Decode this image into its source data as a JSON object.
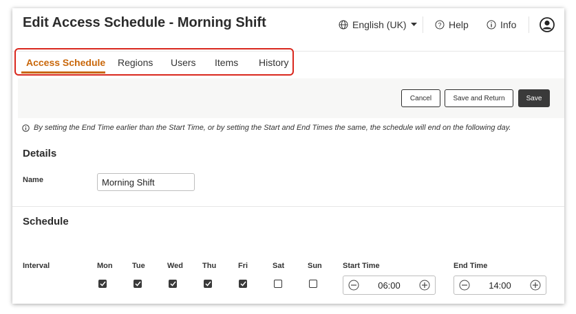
{
  "header": {
    "title": "Edit Access Schedule - Morning Shift",
    "language": "English (UK)",
    "help": "Help",
    "info": "Info"
  },
  "tabs": [
    {
      "label": "Access Schedule",
      "active": true
    },
    {
      "label": "Regions",
      "active": false
    },
    {
      "label": "Users",
      "active": false
    },
    {
      "label": "Items",
      "active": false
    },
    {
      "label": "History",
      "active": false
    }
  ],
  "toolbar": {
    "cancel": "Cancel",
    "save_and_return": "Save and Return",
    "save": "Save"
  },
  "info_text": "By setting the End Time earlier than the Start Time, or by setting the Start and End Times the same, the schedule will end on the following day.",
  "details": {
    "title": "Details",
    "name_label": "Name",
    "name_value": "Morning Shift"
  },
  "schedule": {
    "title": "Schedule",
    "interval_label": "Interval",
    "days": [
      {
        "label": "Mon",
        "checked": true
      },
      {
        "label": "Tue",
        "checked": true
      },
      {
        "label": "Wed",
        "checked": true
      },
      {
        "label": "Thu",
        "checked": true
      },
      {
        "label": "Fri",
        "checked": true
      },
      {
        "label": "Sat",
        "checked": false
      },
      {
        "label": "Sun",
        "checked": false
      }
    ],
    "start_time_label": "Start Time",
    "start_time": "06:00",
    "end_time_label": "End Time",
    "end_time": "14:00"
  },
  "colors": {
    "accent": "#c9670a",
    "highlight_outline": "#d9261c"
  }
}
